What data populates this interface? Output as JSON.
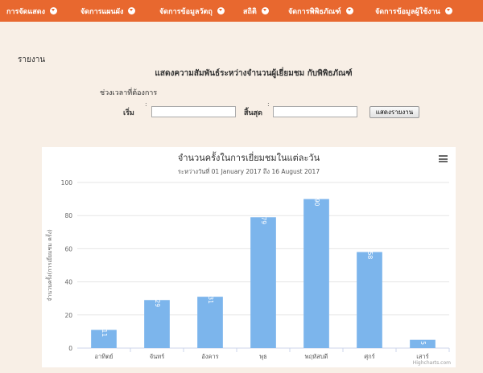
{
  "nav": {
    "items": [
      {
        "label": "การจัดแสดง"
      },
      {
        "label": "จัดการแผนผัง"
      },
      {
        "label": "จัดการข้อมูลวัตถุ"
      },
      {
        "label": "สถิติ"
      },
      {
        "label": "จัดการพิพิธภัณฑ์"
      },
      {
        "label": "จัดการข้อมูลผู้ใช้งาน"
      }
    ]
  },
  "page": {
    "report_label": "รายงาน",
    "heading": "แสดงความสัมพันธ์ระหว่างจำนวนผู้เยี่ยมชม กับพิพิธภัณฑ์",
    "period_label": "ช่วงเวลาที่ต้องการ",
    "start_label": "เริ่ม",
    "end_label": "สิ้นสุด",
    "colon": ":",
    "start_value": "",
    "end_value": "",
    "show_button": "แสดงรายงาน"
  },
  "chart_data": {
    "type": "bar",
    "title": "จำนวนครั้งในการเยี่ยมชมในแต่ละวัน",
    "subtitle": "ระหว่างวันที่ 01 January 2017 ถึง 16 August 2017",
    "ylabel": "จำนวนครั้ง(การเยี่ยมชม ครั้ง)",
    "xlabel": "",
    "categories": [
      "อาทิตย์",
      "จันทร์",
      "อังคาร",
      "พุธ",
      "พฤหัสบดี",
      "ศุกร์",
      "เสาร์"
    ],
    "values": [
      11,
      29,
      31,
      79,
      90,
      58,
      5
    ],
    "ylim": [
      0,
      100
    ],
    "yticks": [
      0,
      20,
      40,
      60,
      80,
      100
    ],
    "bar_color": "#7cb5ec",
    "credits": "Highcharts.com",
    "grid": true,
    "legend": "none"
  }
}
